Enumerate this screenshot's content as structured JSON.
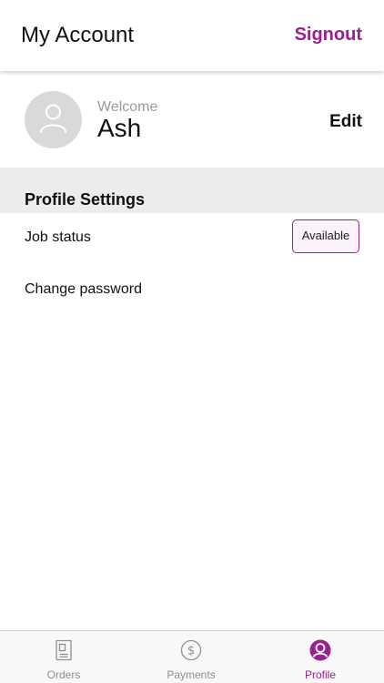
{
  "header": {
    "title": "My Account",
    "signout_label": "Signout"
  },
  "profile": {
    "welcome_label": "Welcome",
    "name": "Ash",
    "edit_label": "Edit"
  },
  "settings": {
    "section_title": "Profile Settings",
    "job_status_label": "Job status",
    "job_status_value": "Available",
    "change_password_label": "Change password"
  },
  "tabs": [
    {
      "label": "Orders",
      "icon": "orders-icon",
      "active": false
    },
    {
      "label": "Payments",
      "icon": "payments-icon",
      "active": false
    },
    {
      "label": "Profile",
      "icon": "profile-icon",
      "active": true
    }
  ],
  "colors": {
    "accent": "#99208f",
    "section_bg": "#ececec",
    "inactive_tab": "#8f8f8f"
  }
}
